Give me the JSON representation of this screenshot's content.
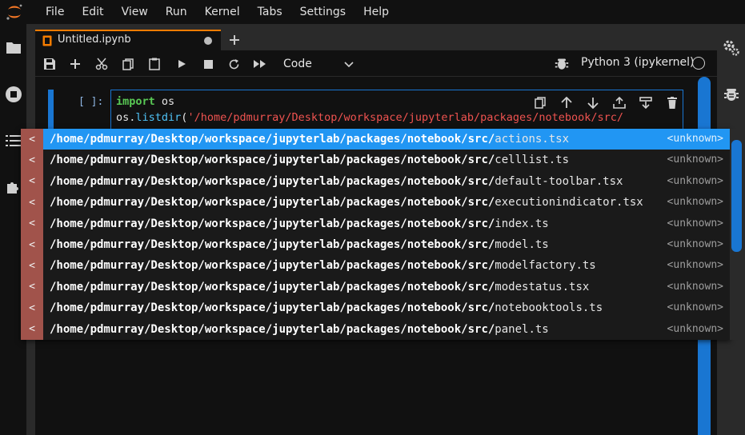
{
  "menu": [
    "File",
    "Edit",
    "View",
    "Run",
    "Kernel",
    "Tabs",
    "Settings",
    "Help"
  ],
  "tab": {
    "label": "Untitled.ipynb"
  },
  "toolbar": {
    "cell_type": "Code",
    "kernel_name": "Python 3 (ipykernel)"
  },
  "cell": {
    "prompt": "[ ]:",
    "line1_kw": "import",
    "line1_rest": " os",
    "line2_obj": "os.",
    "line2_fn": "listdir",
    "line2_paren": "(",
    "line2_str": "'/home/pdmurray/Desktop/workspace/jupyterlab/packages/notebook/src/"
  },
  "completer": {
    "type_glyph": "<",
    "prefix": "/home/pdmurray/Desktop/workspace/jupyterlab/packages/notebook/src/",
    "kind": "<unknown>",
    "items": [
      "actions.tsx",
      "celllist.ts",
      "default-toolbar.tsx",
      "executionindicator.tsx",
      "index.ts",
      "model.ts",
      "modelfactory.ts",
      "modestatus.tsx",
      "notebooktools.ts",
      "panel.ts"
    ]
  },
  "colors": {
    "accent": "#1976d2",
    "selected": "#2196f3",
    "tab_border": "#f57c00",
    "string": "#ef5350",
    "keyword": "#59c955"
  }
}
